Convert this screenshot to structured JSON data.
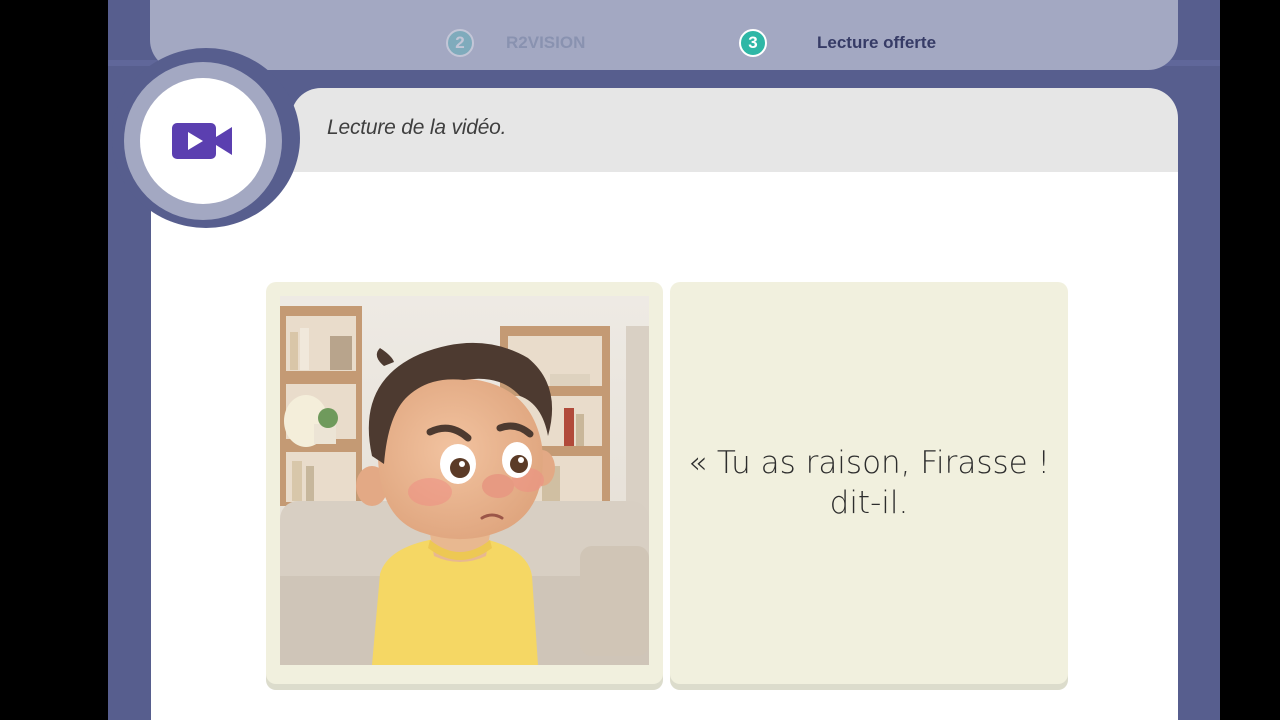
{
  "stepper": {
    "steps": [
      {
        "number": "2",
        "label": "R2VISION"
      },
      {
        "number": "3",
        "label": "Lecture offerte"
      }
    ]
  },
  "header": {
    "title": "Lecture de la vidéo."
  },
  "badge": {
    "icon": "video-camera-icon",
    "color": "#5b3fb0"
  },
  "slide": {
    "illustration": "boy-on-couch-illustration",
    "quote_line1": "« Tu as raison, Firasse !",
    "quote_line2": "dit-il."
  },
  "colors": {
    "frame": "#575e8e",
    "stepper_bg": "#a3a8c2",
    "step_active": "#2fb7a6",
    "card": "#f1f0de"
  }
}
